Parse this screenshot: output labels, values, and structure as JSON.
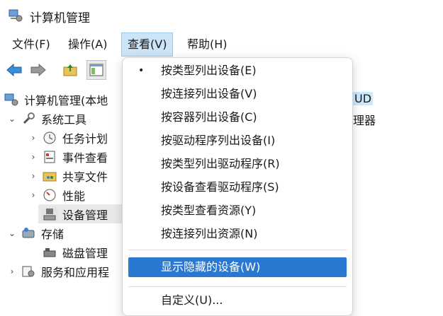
{
  "window": {
    "title": "计算机管理"
  },
  "menubar": {
    "items": [
      {
        "label": "文件(F)"
      },
      {
        "label": "操作(A)"
      },
      {
        "label": "查看(V)"
      },
      {
        "label": "帮助(H)"
      }
    ]
  },
  "tree": {
    "root": "计算机管理(本地",
    "system_tools": "系统工具",
    "task_scheduler": "任务计划",
    "event_viewer": "事件查看",
    "shared_folders": "共享文件",
    "performance": "性能",
    "device_manager": "设备管理",
    "storage": "存储",
    "disk_management": "磁盘管理",
    "services": "服务和应用程"
  },
  "right_pane": {
    "item1": "UD",
    "item2": "理器"
  },
  "view_menu": {
    "items": [
      {
        "label": "按类型列出设备(E)",
        "checked": true
      },
      {
        "label": "按连接列出设备(V)"
      },
      {
        "label": "按容器列出设备(C)"
      },
      {
        "label": "按驱动程序列出设备(I)"
      },
      {
        "label": "按类型列出驱动程序(R)"
      },
      {
        "label": "按设备查看驱动程序(S)"
      },
      {
        "label": "按类型查看资源(Y)"
      },
      {
        "label": "按连接列出资源(N)"
      },
      {
        "label": "显示隐藏的设备(W)",
        "highlighted": true
      },
      {
        "label": "自定义(U)..."
      }
    ],
    "bullet": "•"
  },
  "colors": {
    "highlight": "#2a78d0",
    "open_menu": "#cce4f7"
  }
}
